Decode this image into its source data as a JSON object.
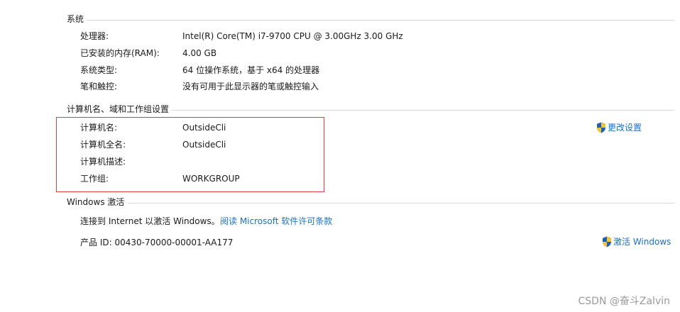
{
  "system": {
    "title": "系统",
    "rows": [
      {
        "label": "处理器:",
        "value": "Intel(R) Core(TM) i7-9700 CPU @ 3.00GHz   3.00 GHz"
      },
      {
        "label": "已安装的内存(RAM):",
        "value": "4.00 GB"
      },
      {
        "label": "系统类型:",
        "value": "64 位操作系统，基于 x64 的处理器"
      },
      {
        "label": "笔和触控:",
        "value": "没有可用于此显示器的笔或触控输入"
      }
    ]
  },
  "computer": {
    "title": "计算机名、域和工作组设置",
    "rows": [
      {
        "label": "计算机名:",
        "value": "OutsideCli"
      },
      {
        "label": "计算机全名:",
        "value": "OutsideCli"
      },
      {
        "label": "计算机描述:",
        "value": ""
      },
      {
        "label": "工作组:",
        "value": "WORKGROUP"
      }
    ],
    "change_settings": "更改设置"
  },
  "activation": {
    "title": "Windows 激活",
    "status_text": "连接到 Internet 以激活 Windows。",
    "license_link": "阅读 Microsoft 软件许可条款",
    "product_id": "产品 ID: 00430-70000-00001-AA177",
    "activate_link": "激活 Windows"
  },
  "watermark": "CSDN @奋斗Zalvin",
  "icons": {
    "shield": "uac-shield-icon"
  },
  "colors": {
    "link": "#1a6fc4",
    "highlight": "#e0393a"
  }
}
